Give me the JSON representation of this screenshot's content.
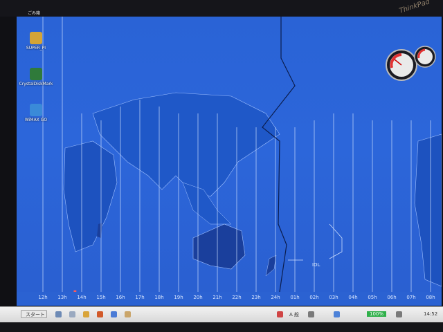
{
  "desktop": {
    "top_label": "ごみ箱",
    "icons": [
      {
        "label": "SUPER_PI",
        "icon": "folder-icon",
        "color": "#d4a436"
      },
      {
        "label": "CrystalDiskMark",
        "icon": "disk-benchmark-icon",
        "color": "#2f7a3a"
      },
      {
        "label": "WiMAX GO",
        "icon": "wimax-icon",
        "color": "#3a8ad8"
      }
    ],
    "map_label": "IDL",
    "hour_labels": [
      "12h",
      "13h",
      "14h",
      "15h",
      "16h",
      "17h",
      "18h",
      "19h",
      "20h",
      "21h",
      "22h",
      "23h",
      "24h",
      "01h",
      "02h",
      "03h",
      "04h",
      "05h",
      "06h",
      "07h",
      "08h"
    ]
  },
  "taskbar": {
    "start_label": "スタート",
    "tray_ime": "A 般",
    "tray_battery": "100%",
    "tray_time": "14:52"
  },
  "bezel": {
    "brand": "ThinkPad"
  },
  "colors": {
    "screen_blue": "#2a63d6",
    "land": "#1d56c4",
    "line": "#cfe0ff",
    "taskbar": "#e2e2e2",
    "battery_green": "#2fb04a"
  }
}
